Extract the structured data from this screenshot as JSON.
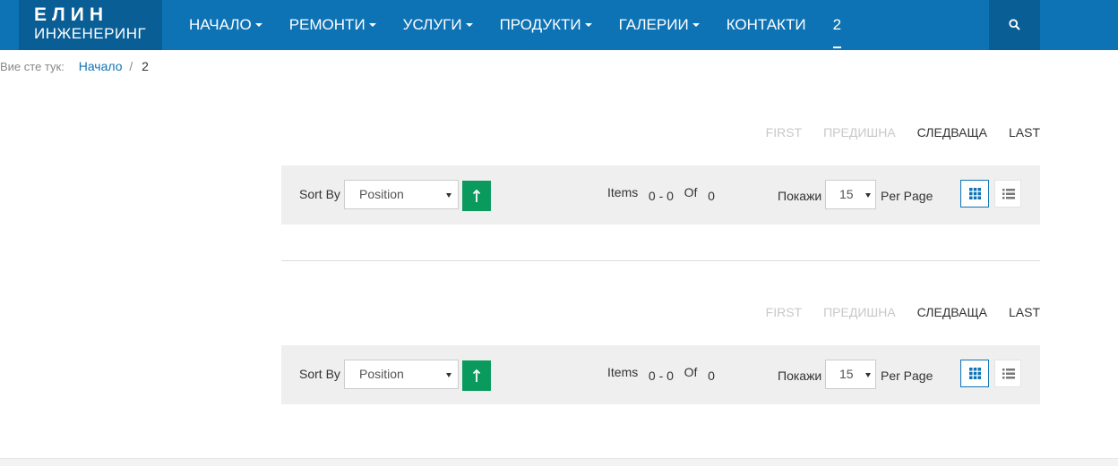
{
  "header": {
    "logo_line1": "ЕЛИН",
    "logo_line2": "ИНЖЕНЕРИНГ",
    "nav": [
      {
        "label": "НАЧАЛО",
        "has_dropdown": true
      },
      {
        "label": "РЕМОНТИ",
        "has_dropdown": true
      },
      {
        "label": "УСЛУГИ",
        "has_dropdown": true
      },
      {
        "label": "ПРОДУКТИ",
        "has_dropdown": true
      },
      {
        "label": "ГАЛЕРИИ",
        "has_dropdown": true
      },
      {
        "label": "КОНТАКТИ",
        "has_dropdown": false
      },
      {
        "label": "2",
        "has_dropdown": false,
        "active": true
      }
    ],
    "search_icon": "search-icon",
    "colors": {
      "bar": "#0e73b5",
      "logo_bg": "#0a5e96"
    }
  },
  "breadcrumb": {
    "prefix": "Вие сте тук:",
    "home": "Начало",
    "separator": "/",
    "current": "2"
  },
  "pagination": {
    "first": "FIRST",
    "prev": "ПРЕДИШНА",
    "next": "СЛЕДВАЩА",
    "last": "LAST"
  },
  "toolbar": {
    "sort_label": "Sort By",
    "sort_value": "Position",
    "sort_dir_icon": "arrow-up-icon",
    "items_label": "Items",
    "items_from": "0",
    "items_dash": "-",
    "items_to": "0",
    "items_of": "Of",
    "items_total": "0",
    "show_label": "Покажи",
    "limit_value": "15",
    "per_page_label": "Per Page",
    "view_grid_icon": "grid-icon",
    "view_list_icon": "list-icon",
    "accent": "#0a9a5e"
  }
}
